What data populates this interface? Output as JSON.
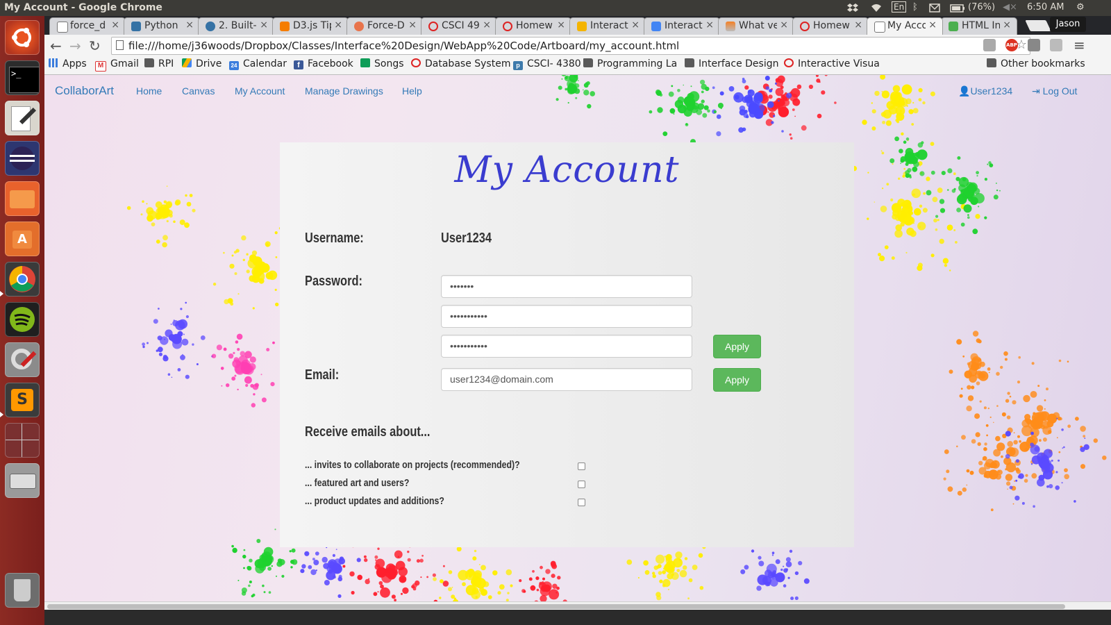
{
  "window": {
    "title": "My Account - Google Chrome"
  },
  "system_tray": {
    "lang": "En",
    "battery": "(76%)",
    "time": "6:50 AM",
    "user": "Jason"
  },
  "launcher": {
    "apps": [
      "ubuntu-dash",
      "terminal",
      "text-editor",
      "eclipse",
      "files",
      "software-center",
      "chrome",
      "spotify",
      "system-settings",
      "sublime-text",
      "workspace-switcher",
      "disk-drive",
      "trash"
    ]
  },
  "tabs": [
    {
      "label": "force_d",
      "icon": "page-icon"
    },
    {
      "label": "Python",
      "icon": "python-icon"
    },
    {
      "label": "2. Built-",
      "icon": "python-icon"
    },
    {
      "label": "D3.js Tip",
      "icon": "blogger-icon"
    },
    {
      "label": "Force-D",
      "icon": "d3-icon"
    },
    {
      "label": "CSCI 49",
      "icon": "cs-icon"
    },
    {
      "label": "Homew",
      "icon": "cs-icon"
    },
    {
      "label": "Interact",
      "icon": "slides-icon"
    },
    {
      "label": "Interact",
      "icon": "docs-icon"
    },
    {
      "label": "What ve",
      "icon": "stackoverflow-icon"
    },
    {
      "label": "Homew",
      "icon": "cs-icon"
    },
    {
      "label": "My Acco",
      "icon": "page-icon",
      "active": true
    },
    {
      "label": "HTML In",
      "icon": "html-icon"
    }
  ],
  "toolbar": {
    "url": "file:///home/j36woods/Dropbox/Classes/Interface%20Design/WebApp%20Code/Artboard/my_account.html"
  },
  "bookmarks": [
    {
      "label": "Apps",
      "icon": "apps-grid-icon"
    },
    {
      "label": "Gmail",
      "icon": "gmail-icon"
    },
    {
      "label": "RPI",
      "icon": "folder-icon"
    },
    {
      "label": "Drive",
      "icon": "drive-icon"
    },
    {
      "label": "Calendar",
      "icon": "calendar-icon"
    },
    {
      "label": "Facebook",
      "icon": "facebook-icon"
    },
    {
      "label": "Songs",
      "icon": "sheets-icon"
    },
    {
      "label": "Database System",
      "icon": "cs-icon"
    },
    {
      "label": "CSCI- 4380",
      "icon": "piazza-icon"
    },
    {
      "label": "Programming La",
      "icon": "folder-icon"
    },
    {
      "label": "Interface Design",
      "icon": "folder-icon"
    },
    {
      "label": "Interactive Visua",
      "icon": "cs-icon"
    },
    {
      "label": "Other bookmarks",
      "icon": "folder-icon"
    }
  ],
  "navbar": {
    "brand": "CollaborArt",
    "links": [
      "Home",
      "Canvas",
      "My Account",
      "Manage Drawings",
      "Help"
    ],
    "user": "User1234",
    "logout": "Log Out"
  },
  "account": {
    "title": "My Account",
    "username_label": "Username:",
    "username_value": "User1234",
    "password_label": "Password:",
    "password_current": "•••••••",
    "password_new": "•••••••••••",
    "password_confirm": "•••••••••••",
    "apply_label": "Apply",
    "email_label": "Email:",
    "email_value": "user1234@domain.com",
    "emails_heading": "Receive emails about...",
    "email_options": [
      {
        "label": "... invites to collaborate on projects (recommended)?",
        "checked": false
      },
      {
        "label": "... featured art and users?",
        "checked": false
      },
      {
        "label": "... product updates and additions?",
        "checked": false
      }
    ]
  },
  "colors": {
    "link": "#337ab7",
    "apply": "#5cb85c",
    "title": "#3a3ccf",
    "launcher": "#8c2b23"
  }
}
